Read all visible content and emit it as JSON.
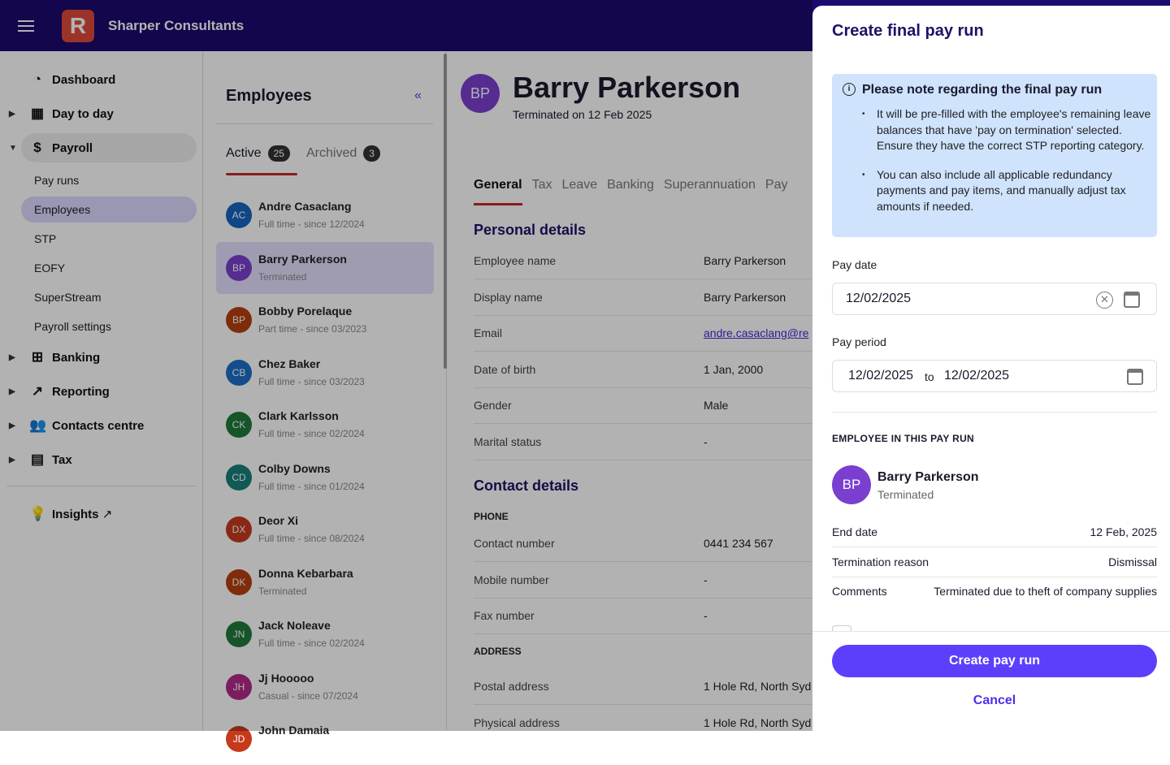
{
  "header": {
    "menu_icon": "hamburger-icon",
    "logo_letter": "R",
    "company": "Sharper Consultants",
    "brand_color": "#1c0a6e"
  },
  "sidebar": {
    "items": [
      {
        "label": "Dashboard",
        "icon": "pie-chart-icon"
      },
      {
        "label": "Day to day",
        "icon": "calendar-icon"
      },
      {
        "label": "Payroll",
        "icon": "dollar-icon"
      },
      {
        "label": "Banking",
        "icon": "bank-icon"
      },
      {
        "label": "Reporting",
        "icon": "trend-icon"
      },
      {
        "label": "Contacts centre",
        "icon": "contacts-icon"
      },
      {
        "label": "Tax",
        "icon": "archive-icon"
      },
      {
        "label": "Insights",
        "icon": "lightbulb-icon"
      }
    ],
    "payroll_sub": [
      "Pay runs",
      "Employees",
      "STP",
      "EOFY",
      "SuperStream",
      "Payroll settings"
    ]
  },
  "employees": {
    "title": "Employees",
    "tabs": [
      {
        "label": "Active",
        "count": "25"
      },
      {
        "label": "Archived",
        "count": "3"
      }
    ],
    "items": [
      {
        "initials": "AC",
        "name": "Andre Casaclang",
        "status": "Full time - since 12/2024",
        "color": "#1565c0"
      },
      {
        "initials": "BP",
        "name": "Barry Parkerson",
        "status": "Terminated",
        "color": "#7b3fd0"
      },
      {
        "initials": "BP",
        "name": "Bobby Porelaque",
        "status": "Part time - since 03/2023",
        "color": "#b5400f"
      },
      {
        "initials": "CB",
        "name": "Chez Baker",
        "status": "Full time - since 03/2023",
        "color": "#1e6fc9"
      },
      {
        "initials": "CK",
        "name": "Clark Karlsson",
        "status": "Full time - since 02/2024",
        "color": "#1f7a3a"
      },
      {
        "initials": "CD",
        "name": "Colby Downs",
        "status": "Full time - since 01/2024",
        "color": "#17807a"
      },
      {
        "initials": "DX",
        "name": "Deor Xi",
        "status": "Full time - since 08/2024",
        "color": "#c53a1d"
      },
      {
        "initials": "DK",
        "name": "Donna Kebarbara",
        "status": "Terminated",
        "color": "#b5400f"
      },
      {
        "initials": "JN",
        "name": "Jack Noleave",
        "status": "Full time - since 02/2024",
        "color": "#1f7a3a"
      },
      {
        "initials": "JH",
        "name": "Jj Hooooo",
        "status": "Casual - since 07/2024",
        "color": "#b02a8a"
      },
      {
        "initials": "JD",
        "name": "John Damaia",
        "status": "",
        "color": "#c53a1d"
      }
    ]
  },
  "detail": {
    "initials": "BP",
    "name": "Barry Parkerson",
    "subtitle": "Terminated on 12 Feb 2025",
    "tabs": [
      "General",
      "Tax",
      "Leave",
      "Banking",
      "Superannuation",
      "Pay"
    ],
    "personal_title": "Personal details",
    "personal": [
      {
        "k": "Employee name",
        "v": "Barry Parkerson"
      },
      {
        "k": "Display name",
        "v": "Barry Parkerson"
      },
      {
        "k": "Email",
        "v": "andre.casaclang@re"
      },
      {
        "k": "Date of birth",
        "v": "1 Jan, 2000"
      },
      {
        "k": "Gender",
        "v": "Male"
      },
      {
        "k": "Marital status",
        "v": "-"
      }
    ],
    "contact_title": "Contact details",
    "phone_cap": "PHONE",
    "phone": [
      {
        "k": "Contact number",
        "v": "0441 234 567"
      },
      {
        "k": "Mobile number",
        "v": "-"
      },
      {
        "k": "Fax number",
        "v": "-"
      }
    ],
    "address_cap": "ADDRESS",
    "address": [
      {
        "k": "Postal address",
        "v": "1 Hole Rd, North Syd"
      },
      {
        "k": "Physical address",
        "v": "1 Hole Rd, North Syd"
      }
    ]
  },
  "modal": {
    "title": "Create final pay run",
    "note_title": "Please note regarding the final pay run",
    "note_items": [
      "It will be pre-filled with the employee's remaining leave balances that have 'pay on termination' selected. Ensure they have the correct STP reporting category.",
      "You can also include all applicable redundancy payments and pay items, and manually adjust tax amounts if needed."
    ],
    "pay_date_label": "Pay date",
    "pay_date": "12/02/2025",
    "pay_period_label": "Pay period",
    "period_from": "12/02/2025",
    "period_to_label": "to",
    "period_to": "12/02/2025",
    "employee_caption": "EMPLOYEE IN THIS PAY RUN",
    "employee": {
      "initials": "BP",
      "name": "Barry Parkerson",
      "status": "Terminated"
    },
    "rows": [
      {
        "k": "End date",
        "v": "12 Feb, 2025"
      },
      {
        "k": "Termination reason",
        "v": "Dismissal"
      },
      {
        "k": "Comments",
        "v": "Terminated due to theft of company supplies"
      }
    ],
    "create_label": "Create pay run",
    "cancel_label": "Cancel",
    "accent": "#5b3ffd"
  }
}
